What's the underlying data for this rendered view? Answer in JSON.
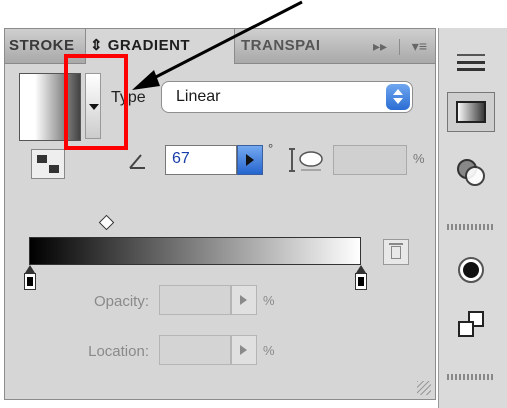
{
  "tabs": [
    {
      "label": "STROKE"
    },
    {
      "label": "⇕ GRADIENT"
    },
    {
      "label": "TRANSPARENCY"
    }
  ],
  "tab_controls": {
    "expand_icon": "double-chevron-right-icon",
    "menu_icon": "panel-menu-icon",
    "expand_label": "▸▸",
    "menu_label": "▾≡"
  },
  "gradient": {
    "type_label": "Type",
    "type_value": "Linear",
    "angle_value": "67",
    "degree_symbol": "°",
    "aspect_value": "",
    "aspect_unit": "%",
    "opacity_label": "Opacity:",
    "opacity_unit": "%",
    "location_label": "Location:",
    "location_unit": "%",
    "ramp_start_color": "#000000",
    "ramp_end_color": "#ffffff",
    "left_stop_color": "#000000",
    "right_stop_color": "#000000"
  },
  "annotation": {
    "box_color": "#ff0000",
    "arrow_color": "#000000"
  },
  "dock_icons": [
    "panel-grip-icon",
    "gradient-panel-icon",
    "transparency-panel-icon",
    "appearance-panel-icon",
    "layers-panel-icon"
  ]
}
